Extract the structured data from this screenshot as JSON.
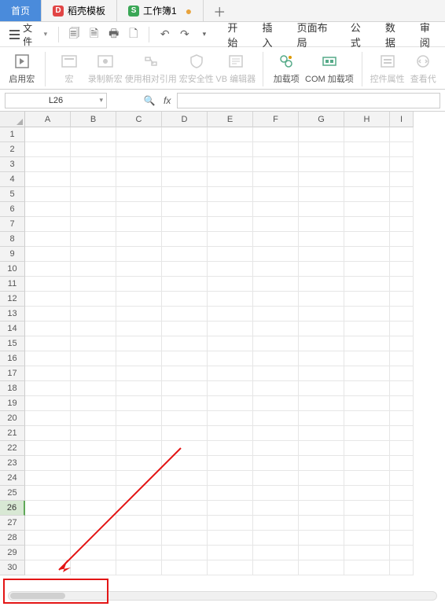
{
  "tabs": {
    "home": "首页",
    "template": "稻壳模板",
    "workbook": "工作簿1"
  },
  "menubar": {
    "file": "文件"
  },
  "menu": {
    "start": "开始",
    "insert": "插入",
    "pagelayout": "页面布局",
    "formula": "公式",
    "data": "数据",
    "review": "审阅"
  },
  "ribbon": {
    "enable_macro": "启用宏",
    "macro": "宏",
    "record_macro": "录制新宏",
    "relative_ref": "使用相对引用",
    "macro_security": "宏安全性",
    "vb_editor": "VB 编辑器",
    "addins": "加载项",
    "com_addins": "COM 加载项",
    "control_props": "控件属性",
    "view_code": "查看代"
  },
  "namebox": {
    "value": "L26"
  },
  "columns": [
    "A",
    "B",
    "C",
    "D",
    "E",
    "F",
    "G",
    "H",
    "I"
  ],
  "rows_from": 1,
  "rows_to": 30,
  "selected_row": 26
}
